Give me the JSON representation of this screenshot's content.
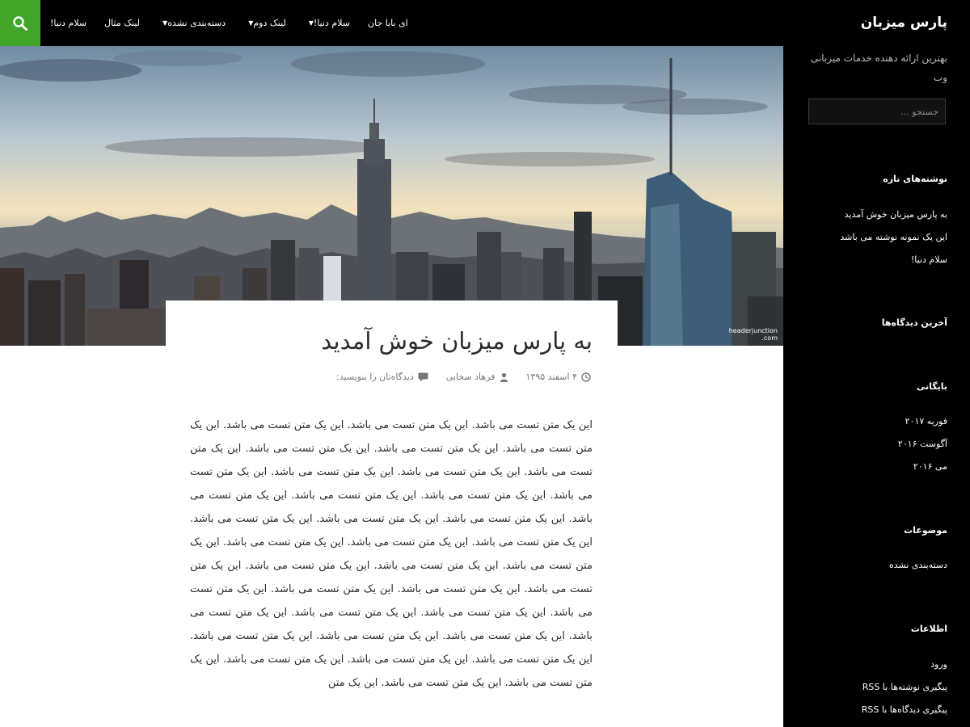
{
  "site": {
    "title": "پارس میزبان",
    "description": "بهترین ارائه دهنده خدمات میزبانی وب"
  },
  "search": {
    "placeholder": "جستجو ..."
  },
  "nav": {
    "items": [
      {
        "label": "سلام دنیا!",
        "has_caret": false
      },
      {
        "label": "لینک مثال",
        "has_caret": false
      },
      {
        "label": "دسته‌بندی نشده",
        "has_caret": true
      },
      {
        "label": "لینک دوم",
        "has_caret": true
      },
      {
        "label": "سلام دنیا!",
        "has_caret": true
      },
      {
        "label": "ای بابا جان",
        "has_caret": false
      }
    ]
  },
  "post": {
    "title": "به پارس میزبان خوش آمدید",
    "date": "۴ اسفند ۱۳۹۵",
    "author": "فرهاد سخایی",
    "comments": "دیدگاه‌تان را بنویسید:",
    "body": "این یک متن تست می باشد. این یک متن تست می باشد. این یک متن تست می باشد. این یک متن تست می باشد. این یک متن تست می باشد. این یک متن تست می باشد. این یک متن تست می باشد. این یک متن تست می باشد. این یک متن تست می باشد. این یک متن تست می باشد. این یک متن تست می باشد. این یک متن تست می باشد. این یک متن تست می باشد. این یک متن تست می باشد. این یک متن تست می باشد. این یک متن تست می باشد. این یک متن تست می باشد. این یک متن تست می باشد. این یک متن تست می باشد. این یک متن تست می باشد. این یک متن تست می باشد. این یک متن تست می باشد. این یک متن تست می باشد. این یک متن تست می باشد. این یک متن تست می باشد. این یک متن تست می باشد. این یک متن تست می باشد. این یک متن تست می باشد. این یک متن تست می باشد. این یک متن تست می باشد. این یک متن تست می باشد. این یک متن تست می باشد. این یک متن تست می باشد. این یک متن تست می باشد. این یک متن تست می باشد. این یک متن تست می باشد. این یک متن تست می باشد. این یک متن"
  },
  "sidebar": {
    "recent_posts": {
      "title": "نوشته‌های تازه",
      "items": [
        "به پارس میزبان خوش آمدید",
        "این یک نمونه نوشته می باشد",
        "سلام دنیا!"
      ]
    },
    "recent_comments": {
      "title": "آخرین دیدگاه‌ها"
    },
    "archives": {
      "title": "بایگانی",
      "items": [
        "فوریه ۲۰۱۷",
        "آگوست ۲۰۱۶",
        "می ۲۰۱۶"
      ]
    },
    "categories": {
      "title": "موضوعات",
      "items": [
        "دسته‌بندی نشده"
      ]
    },
    "meta": {
      "title": "اطلاعات",
      "items": [
        "ورود",
        "پیگیری نوشته‌ها با RSS",
        "پیگیری دیدگاه‌ها با RSS"
      ]
    }
  },
  "hero": {
    "watermark_line1": "headerjunction",
    "watermark_line2": ".com"
  },
  "colors": {
    "accent": "#41a62a",
    "topbar": "#000000",
    "sidebar": "#000000"
  },
  "icons": [
    "search-icon",
    "clock-icon",
    "user-icon",
    "comment-icon"
  ]
}
